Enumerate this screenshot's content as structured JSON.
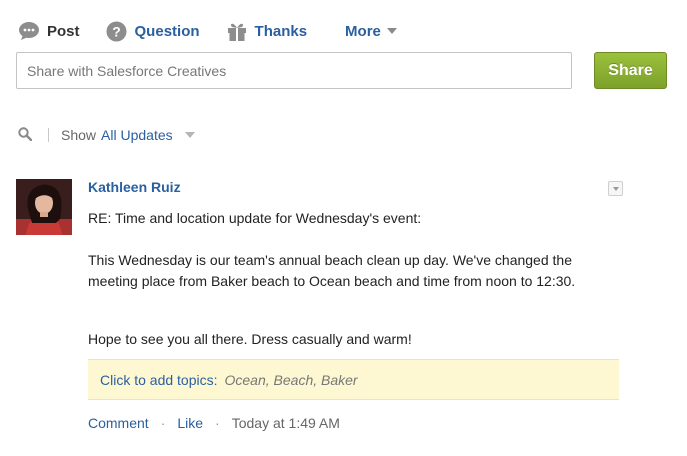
{
  "publisher": {
    "tabs": [
      {
        "label": "Post",
        "icon": "speech-bubble-icon",
        "active": true
      },
      {
        "label": "Question",
        "icon": "question-icon",
        "active": false
      },
      {
        "label": "Thanks",
        "icon": "gift-icon",
        "active": false
      }
    ],
    "more_label": "More",
    "share_placeholder": "Share with Salesforce Creatives",
    "share_button": "Share"
  },
  "filter": {
    "show_label": "Show",
    "selected": "All Updates"
  },
  "feed_item": {
    "author": "Kathleen Ruiz",
    "subject": "RE: Time and location update for Wednesday's event:",
    "paragraph1": "This Wednesday is our team's annual beach clean up day. We've changed the meeting place from Baker beach to Ocean beach and time from noon to 12:30.",
    "paragraph2": "Hope to see you all there. Dress casually and warm!",
    "topics_link": "Click to add topics:",
    "topics": "Ocean, Beach, Baker",
    "comment_label": "Comment",
    "like_label": "Like",
    "separator": "·",
    "timestamp": "Today at 1:49 AM"
  },
  "colors": {
    "link": "#2a5fa0",
    "share_button": "#8bb034",
    "topics_bg": "#fdf8d2"
  }
}
